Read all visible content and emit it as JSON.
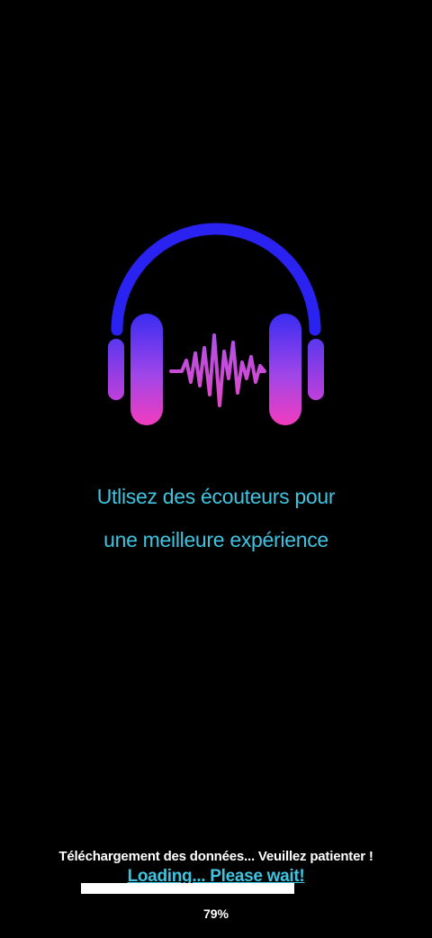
{
  "tagline": {
    "line1": "Utlisez des écouteurs pour",
    "line2": "une meilleure expérience"
  },
  "loading": {
    "status_fr": "Téléchargement des données... Veuillez patienter !",
    "status_en": "Loading... Please wait!",
    "progress_fraction": 0.79,
    "percent_label": "79%"
  },
  "icons": {
    "logo": "headphones-soundwave-icon"
  },
  "colors": {
    "background": "#000000",
    "accent_text": "#3fc3df",
    "headband_blue": "#2a22f0",
    "cup_pink": "#f03cc0",
    "progress_fill": "#ffffff"
  }
}
